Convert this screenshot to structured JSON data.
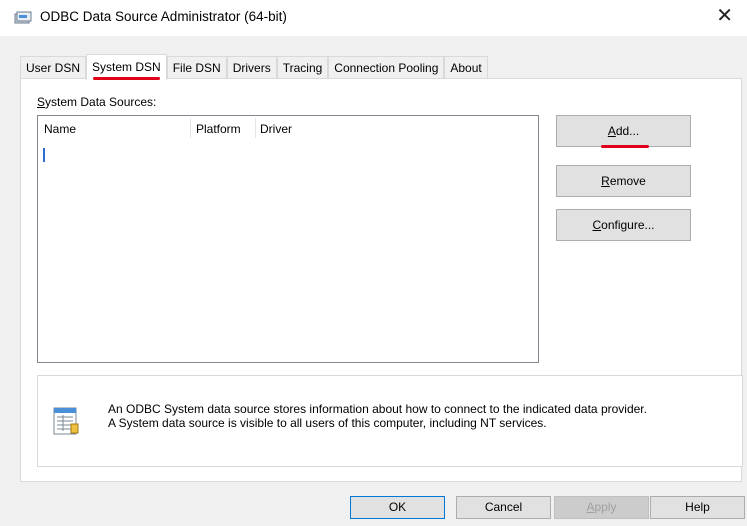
{
  "window": {
    "title": "ODBC Data Source Administrator (64-bit)",
    "close_glyph": "✕"
  },
  "tabs": [
    {
      "label": "User DSN"
    },
    {
      "label": "System DSN",
      "active": true
    },
    {
      "label": "File DSN"
    },
    {
      "label": "Drivers"
    },
    {
      "label": "Tracing"
    },
    {
      "label": "Connection Pooling"
    },
    {
      "label": "About"
    }
  ],
  "panel": {
    "list_label_mnemonic": "S",
    "list_label_rest": "ystem Data Sources:",
    "columns": [
      "Name",
      "Platform",
      "Driver"
    ],
    "add": {
      "mnemonic": "A",
      "rest": "dd..."
    },
    "remove": {
      "mnemonic": "R",
      "rest": "emove"
    },
    "configure": {
      "mnemonic": "C",
      "rest": "onfigure..."
    },
    "info_line1": "An ODBC System data source stores information about how to connect to the indicated data provider.",
    "info_line2": "A System data source is visible to all users of this computer, including NT services."
  },
  "footer": {
    "ok": "OK",
    "cancel": "Cancel",
    "apply_mnemonic": "A",
    "apply_rest": "pply",
    "help": "Help"
  },
  "colors": {
    "highlight": "#e0001a",
    "focus": "#0078d7"
  },
  "icons": [
    "odbc-app-icon",
    "data-source-icon"
  ]
}
